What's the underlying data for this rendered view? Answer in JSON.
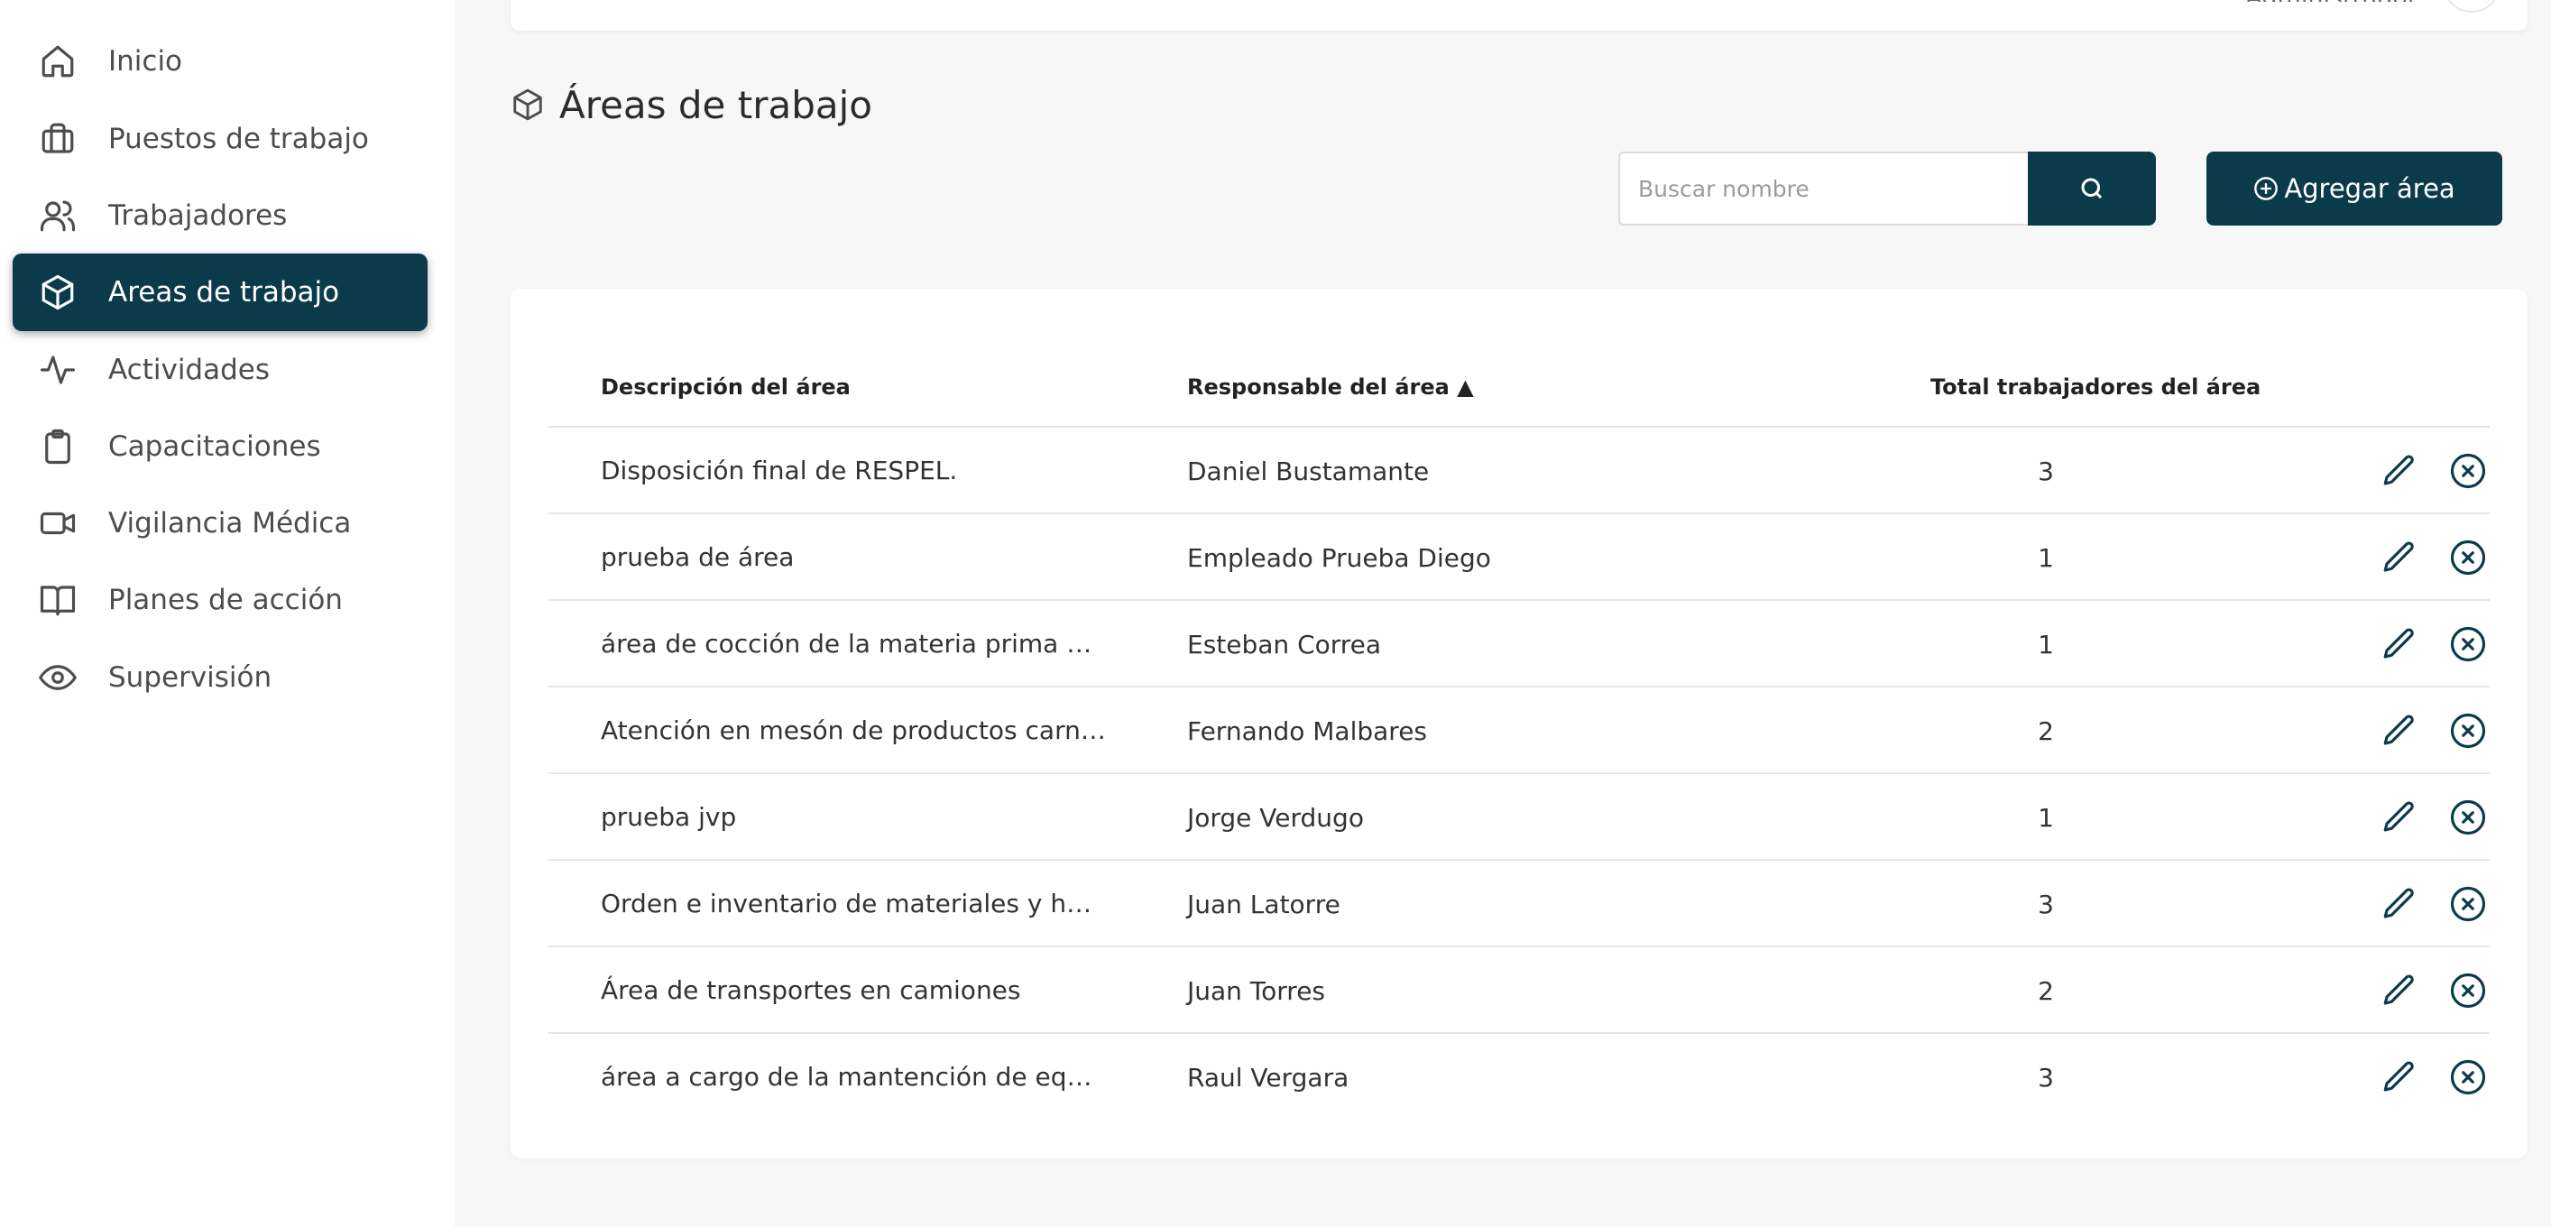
{
  "theme": {
    "primary": "#0b3b4b",
    "background": "#f7f7f7",
    "sidebar_bg": "#ffffff"
  },
  "header": {
    "role": "Administrador"
  },
  "sidebar": {
    "items": [
      {
        "label": "Inicio",
        "icon": "home-icon"
      },
      {
        "label": "Puestos de trabajo",
        "icon": "briefcase-icon"
      },
      {
        "label": "Trabajadores",
        "icon": "users-icon"
      },
      {
        "label": "Areas de trabajo",
        "icon": "box-icon",
        "active": true
      },
      {
        "label": "Actividades",
        "icon": "activity-icon"
      },
      {
        "label": "Capacitaciones",
        "icon": "clipboard-icon"
      },
      {
        "label": "Vigilancia Médica",
        "icon": "video-icon"
      },
      {
        "label": "Planes de acción",
        "icon": "book-icon"
      },
      {
        "label": "Supervisión",
        "icon": "eye-icon"
      }
    ]
  },
  "page": {
    "title": "Áreas de trabajo",
    "title_icon": "box-icon"
  },
  "search": {
    "placeholder": "Buscar nombre",
    "value": ""
  },
  "add_button": {
    "label": "Agregar área",
    "icon": "plus-circle-icon"
  },
  "table": {
    "columns": {
      "description": "Descripción del área",
      "responsible": "Responsable del área ▲",
      "total": "Total trabajadores del área"
    },
    "rows": [
      {
        "description": "Disposición final de RESPEL.",
        "responsible": "Daniel Bustamante",
        "total": "3"
      },
      {
        "description": "prueba de área",
        "responsible": "Empleado Prueba Diego",
        "total": "1"
      },
      {
        "description": "área de cocción de la materia prima que d...",
        "responsible": "Esteban Correa",
        "total": "1"
      },
      {
        "description": "Atención en mesón de productos carnes y...",
        "responsible": "Fernando Malbares",
        "total": "2"
      },
      {
        "description": "prueba jvp",
        "responsible": "Jorge Verdugo",
        "total": "1"
      },
      {
        "description": "Orden e inventario de materiales y herram...",
        "responsible": "Juan Latorre",
        "total": "3"
      },
      {
        "description": "Área de transportes en camiones",
        "responsible": "Juan Torres",
        "total": "2"
      },
      {
        "description": "área a cargo de la mantención de equipos...",
        "responsible": "Raul Vergara",
        "total": "3"
      }
    ],
    "row_actions": [
      "edit-icon",
      "delete-icon"
    ]
  }
}
